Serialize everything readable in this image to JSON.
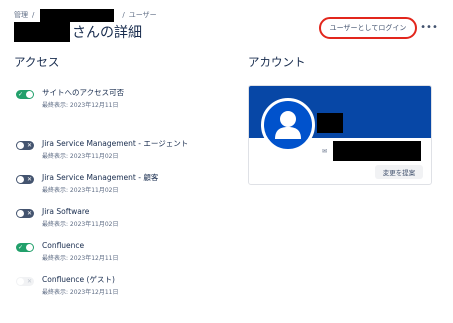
{
  "breadcrumb": {
    "root": "管理",
    "sep1": "/",
    "sep2": "/",
    "current": "ユーザー"
  },
  "page": {
    "title_suffix": "さんの詳細"
  },
  "actions": {
    "login_as_user": "ユーザーとしてログイン",
    "more": "•••"
  },
  "access": {
    "heading": "アクセス",
    "items": [
      {
        "name": "サイトへのアクセス可否",
        "last_seen": "最終表示: 2023年12月11日",
        "state": "on",
        "mark": "✓"
      },
      {
        "name": "Jira Service Management - エージェント",
        "last_seen": "最終表示: 2023年11月02日",
        "state": "off",
        "mark": "✕"
      },
      {
        "name": "Jira Service Management - 顧客",
        "last_seen": "最終表示: 2023年11月02日",
        "state": "off",
        "mark": "✕"
      },
      {
        "name": "Jira Software",
        "last_seen": "最終表示: 2023年11月02日",
        "state": "off",
        "mark": "✕"
      },
      {
        "name": "Confluence",
        "last_seen": "最終表示: 2023年12月11日",
        "state": "on",
        "mark": "✓"
      },
      {
        "name": "Confluence (ゲスト)",
        "last_seen": "最終表示: 2023年12月11日",
        "state": "disabled",
        "mark": "✕"
      }
    ]
  },
  "account": {
    "heading": "アカウント",
    "mail_icon": "✉",
    "suggest_change": "変更を提案"
  },
  "colors": {
    "accent_banner": "#0747a6",
    "avatar_bg": "#0052cc",
    "toggle_on": "#22a06b",
    "toggle_off": "#44546f",
    "highlight_outline": "#e2261c"
  },
  "icons": [
    "chevron-separator",
    "more-icon",
    "toggle-check-icon",
    "toggle-cross-icon",
    "user-avatar-icon",
    "mail-icon"
  ]
}
